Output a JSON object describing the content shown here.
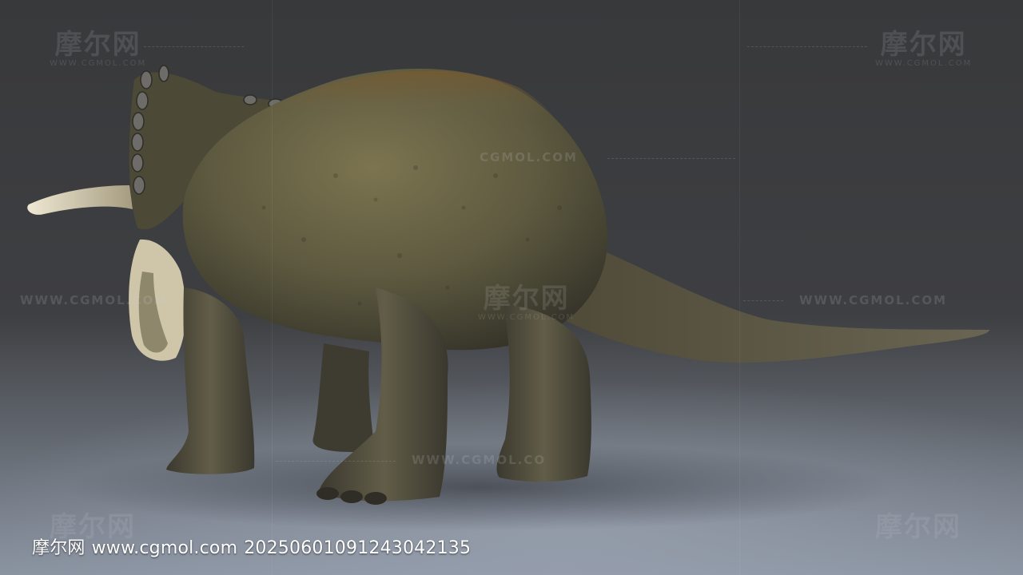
{
  "watermark": {
    "brand": "摩尔网",
    "domain_caps": "WWW.CGMOL.COM",
    "domain_short": "CGMOL.COM",
    "domain_partial": "WWW.CGMOL.CO"
  },
  "caption": {
    "site_name": "摩尔网",
    "url": "www.cgmol.com",
    "id": "20250601091243042135"
  },
  "colors": {
    "background": "#3a3b3d",
    "floor": "#7f8896",
    "skin_dark": "#4a4736",
    "skin_mid": "#6b6446",
    "skin_rust": "#7a5a2e",
    "horn": "#d8d0b6"
  }
}
